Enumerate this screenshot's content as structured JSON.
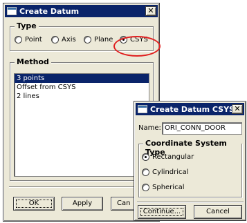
{
  "create_datum": {
    "title": "Create Datum",
    "close_glyph": "✕",
    "type_group": {
      "label": "Type",
      "options": [
        {
          "label": "Point",
          "checked": false
        },
        {
          "label": "Axis",
          "checked": false
        },
        {
          "label": "Plane",
          "checked": false
        },
        {
          "label": "CSYS",
          "checked": true
        }
      ]
    },
    "method_group": {
      "label": "Method",
      "items": [
        {
          "label": "3 points",
          "selected": true
        },
        {
          "label": "Offset from CSYS",
          "selected": false
        },
        {
          "label": "2 lines",
          "selected": false
        }
      ]
    },
    "buttons": {
      "ok": "OK",
      "apply": "Apply",
      "cancel": "Can"
    },
    "annotation_color": "#e02020"
  },
  "create_datum_csys": {
    "title": "Create Datum CSYS",
    "close_glyph": "✕",
    "name_label": "Name:",
    "name_value": "ORI_CONN_DOOR",
    "coord_group": {
      "label": "Coordinate System Type",
      "options": [
        {
          "label": "Rectangular",
          "checked": true
        },
        {
          "label": "Cylindrical",
          "checked": false
        },
        {
          "label": "Spherical",
          "checked": false
        }
      ]
    },
    "buttons": {
      "continue": "Continue...",
      "cancel": "Cancel"
    }
  },
  "colors": {
    "titlebar": "#0a246a",
    "dialog_bg": "#ece9d8",
    "selection": "#0a246a"
  }
}
